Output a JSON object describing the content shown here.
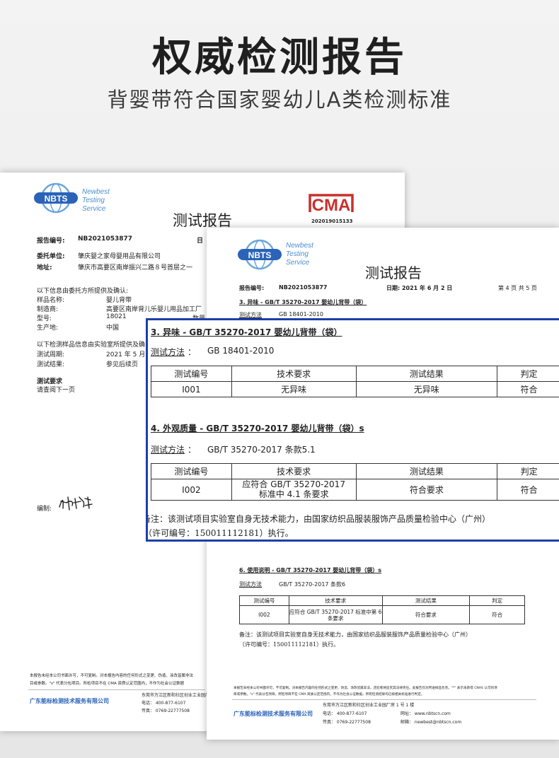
{
  "header": {
    "title": "权威检测报告",
    "subtitle": "背婴带符合国家婴幼儿A类检测标准"
  },
  "logo": {
    "abbr": "NBTS",
    "line1": "Newbest",
    "line2": "Testing",
    "line3": "Service"
  },
  "cma": {
    "mark": "CMA",
    "number": "202019015133"
  },
  "report1": {
    "title": "测试报告",
    "report_no_label": "报告编号:",
    "report_no": "NB2021053877",
    "date_label": "日",
    "client_label": "委托单位:",
    "client": "肇庆婴之家母婴用品有限公司",
    "address_label": "地址:",
    "address": "肇庆市高要区南岸振兴二路８号首层之一",
    "info_intro": "以下信息由委托方所提供及确认:",
    "sample_label": "样品名称:",
    "sample": "婴儿背带",
    "maker_label": "制造商:",
    "maker": "高要区南岸背儿乐婴儿用品加工厂",
    "model_label": "型号:",
    "model": "18021",
    "qty_label": "数量",
    "origin_label": "生产地:",
    "origin": "中国",
    "lab_intro": "以下检测样品信息由实验室所提供及确",
    "period_label": "测试周期:",
    "period": "2021 年 5 月",
    "result_label": "测试结果:",
    "result": "参见后续页",
    "req_label": "测试要求",
    "req": "请查阅下一页",
    "editor_label": "编制:",
    "signature": "叶艳芳",
    "footnote1": "本报告未经本公司书面许可，不可复制。对本报告内容的任何形式之变更、伪造、涂改皆属非法",
    "footnote2": "目或参数。\"s\" 代表分包项目。所检项目不在 CMA 资质认定范围内，不作为社会公证数据",
    "company": "广东能标检测技术服务有限公司",
    "addr": "东莞市万江区新和社区创业工业园厂",
    "phone": "电话：  400-877-6107",
    "fax": "传真：  0769-22777508"
  },
  "report2": {
    "title": "测试报告",
    "report_no_label": "报告编号:",
    "report_no": "NB2021053877",
    "date": "日期:  2021 年 6 月 2 日",
    "page": "第 4 页  共 5 页",
    "s3_title": "3.  异味  - GB/T 35270-2017  婴幼儿背带（袋）",
    "s3_method_label": "测试方法",
    "s3_method": "GB 18401-2010",
    "s6_title": "6.  使用说明  - GB/T 35270-2017  婴幼儿背带（袋）s",
    "s6_method_label": "测试方法",
    "s6_method": "GB/T 35270-2017  条款6",
    "s6_headers": [
      "测试编号",
      "技术要求",
      "测试结果",
      "判定"
    ],
    "s6_row": [
      "I002",
      "应符合 GB/T 35270-2017 标准中第 6 条要求",
      "符合要求",
      "符合"
    ],
    "note1": "备注：该测试项目实验室自身无技术能力，由国家纺织品服装服饰产品质量检验中心（广州）",
    "note2": "（许可编号：150011112181）执行。",
    "footnote1": "本报告未经本公司书面许可，不可复制。对本报告内容的任何形式之变更、伪造、涂改皆属非法，违犯者将追究其法律责任。此报告仅对所送样品负责。\"*\" 表示未获得 CNAS 认可的项",
    "footnote2": "目或参数。\"s\" 代表分包项目。所检项目不在 CMA 资质认定范围内，不作为社会公证数据。所有检测结果均已按相关标准进行判定。",
    "company": "广东能标检测技术服务有限公司",
    "addr": "东莞市万江区新和社区创业工业园厂房 1 号 1 楼",
    "phone": "电话：  400-877-6107",
    "web": "网址：  www.nbtscn.com",
    "fax": "传真：  0769-22777508",
    "mail": "邮箱：  newbest@nbtscn.com"
  },
  "zoom": {
    "s3_title": "3.  异味  - GB/T 35270-2017  婴幼儿背带（袋）",
    "s3_method_label": "测试方法",
    "s3_method": "GB 18401-2010",
    "s3_headers": [
      "测试编号",
      "技术要求",
      "测试结果",
      "判定"
    ],
    "s3_row": [
      "I001",
      "无异味",
      "无异味",
      "符合"
    ],
    "s4_title": "4.  外观质量  - GB/T 35270-2017  婴幼儿背带（袋）s",
    "s4_method_label": "测试方法",
    "s4_method": "GB/T 35270-2017  条款5.1",
    "s4_headers": [
      "测试编号",
      "技术要求",
      "测试结果",
      "判定"
    ],
    "s4_row": [
      "I002",
      "应符合 GB/T 35270-2017",
      "标准中 4.1 条要求",
      "符合要求",
      "符合"
    ],
    "note1": "备注：该测试项目实验室自身无技术能力，由国家纺织品服装服饰产品质量检验中心（广州）",
    "note2": "（许可编号：150011112181）执行。"
  },
  "colors": {
    "frame": "#1d3fa8",
    "nbts_blue": "#2a63b8",
    "cma_red": "#c9302c"
  }
}
